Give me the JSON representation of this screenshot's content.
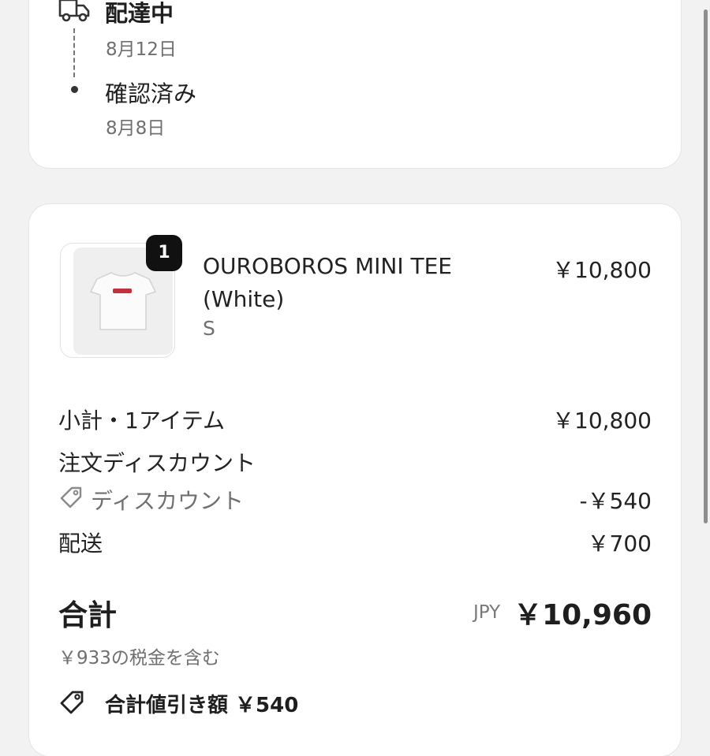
{
  "timeline": {
    "steps": [
      {
        "status": "配達中",
        "date": "8月12日",
        "icon": "truck-icon"
      },
      {
        "status": "確認済み",
        "date": "8月8日",
        "icon": "dot-icon"
      }
    ]
  },
  "order": {
    "item": {
      "quantity": "1",
      "name_line1": "OUROBOROS MINI TEE",
      "name_line2": "(White)",
      "variant": "S",
      "price": "￥10,800",
      "image": "tshirt-thumbnail"
    },
    "summary": {
      "subtotal_label": "小計・1アイテム",
      "subtotal_value": "￥10,800",
      "order_discount_label": "注文ディスカウント",
      "discount_label": "ディスカウント",
      "discount_value": "-￥540",
      "shipping_label": "配送",
      "shipping_value": "￥700",
      "total_label": "合計",
      "currency": "JPY",
      "total_value": "￥10,960",
      "tax_note": "￥933の税金を含む",
      "total_savings": "合計値引き額 ￥540"
    }
  },
  "colors": {
    "background": "#f2f2f2",
    "card": "#ffffff",
    "text": "#1e1e1e",
    "muted": "#707070",
    "badge": "#111111"
  }
}
